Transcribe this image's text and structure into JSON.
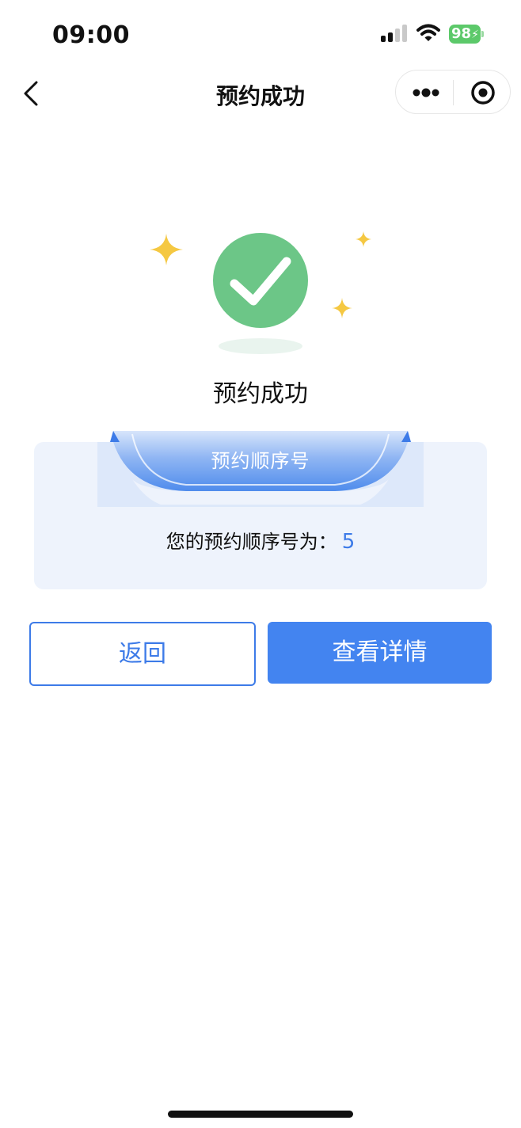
{
  "status_bar": {
    "time": "09:00",
    "battery_level": "98",
    "battery_charging": true,
    "battery_color": "#5cc96a"
  },
  "nav": {
    "title": "预约成功",
    "back_icon": "chevron-left-icon",
    "more_icon": "more-dots-icon",
    "close_icon": "target-circle-icon"
  },
  "result": {
    "icon": "check-circle-icon",
    "icon_color": "#6cc687",
    "sparkle_color": "#f5c842",
    "title": "预约成功"
  },
  "order_card": {
    "banner_label": "预约顺序号",
    "info_label": "您的预约顺序号为：",
    "number": "5",
    "accent_color": "#3d7be8"
  },
  "actions": {
    "back_label": "返回",
    "detail_label": "查看详情",
    "primary_color": "#4384f0"
  }
}
